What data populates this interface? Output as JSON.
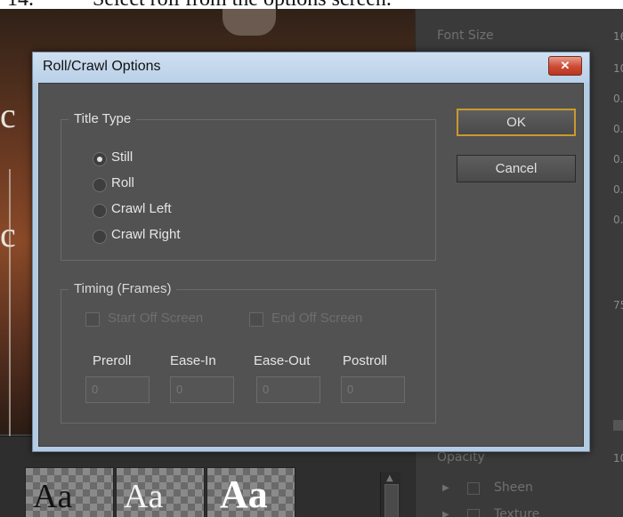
{
  "caption": {
    "number": "14.",
    "text": "Select roll from the options screen."
  },
  "right_panel": {
    "font_size_label": "Font Size",
    "opacity_label": "Opacity",
    "sheen_label": "Sheen",
    "texture_label": "Texture",
    "values": [
      "16",
      "10",
      "0.",
      "0.",
      "0.",
      "0.",
      "0.",
      "75",
      "10"
    ]
  },
  "styles": {
    "tiles": [
      "Aa",
      "Aa",
      "Aa"
    ]
  },
  "dialog": {
    "title": "Roll/Crawl Options",
    "close_glyph": "✕",
    "title_type": {
      "legend": "Title Type",
      "options": [
        {
          "label": "Still",
          "checked": true
        },
        {
          "label": "Roll",
          "checked": false
        },
        {
          "label": "Crawl Left",
          "checked": false
        },
        {
          "label": "Crawl Right",
          "checked": false
        }
      ]
    },
    "timing": {
      "legend": "Timing (Frames)",
      "start_off_screen": "Start Off Screen",
      "end_off_screen": "End Off Screen",
      "columns": [
        {
          "label": "Preroll",
          "value": "0"
        },
        {
          "label": "Ease-In",
          "value": "0"
        },
        {
          "label": "Ease-Out",
          "value": "0"
        },
        {
          "label": "Postroll",
          "value": "0"
        }
      ]
    },
    "ok_label": "OK",
    "cancel_label": "Cancel"
  },
  "colors": {
    "accent_default_button": "#c99a2e",
    "close_button": "#cd4a34",
    "dialog_frame": "#b5cbe2"
  }
}
